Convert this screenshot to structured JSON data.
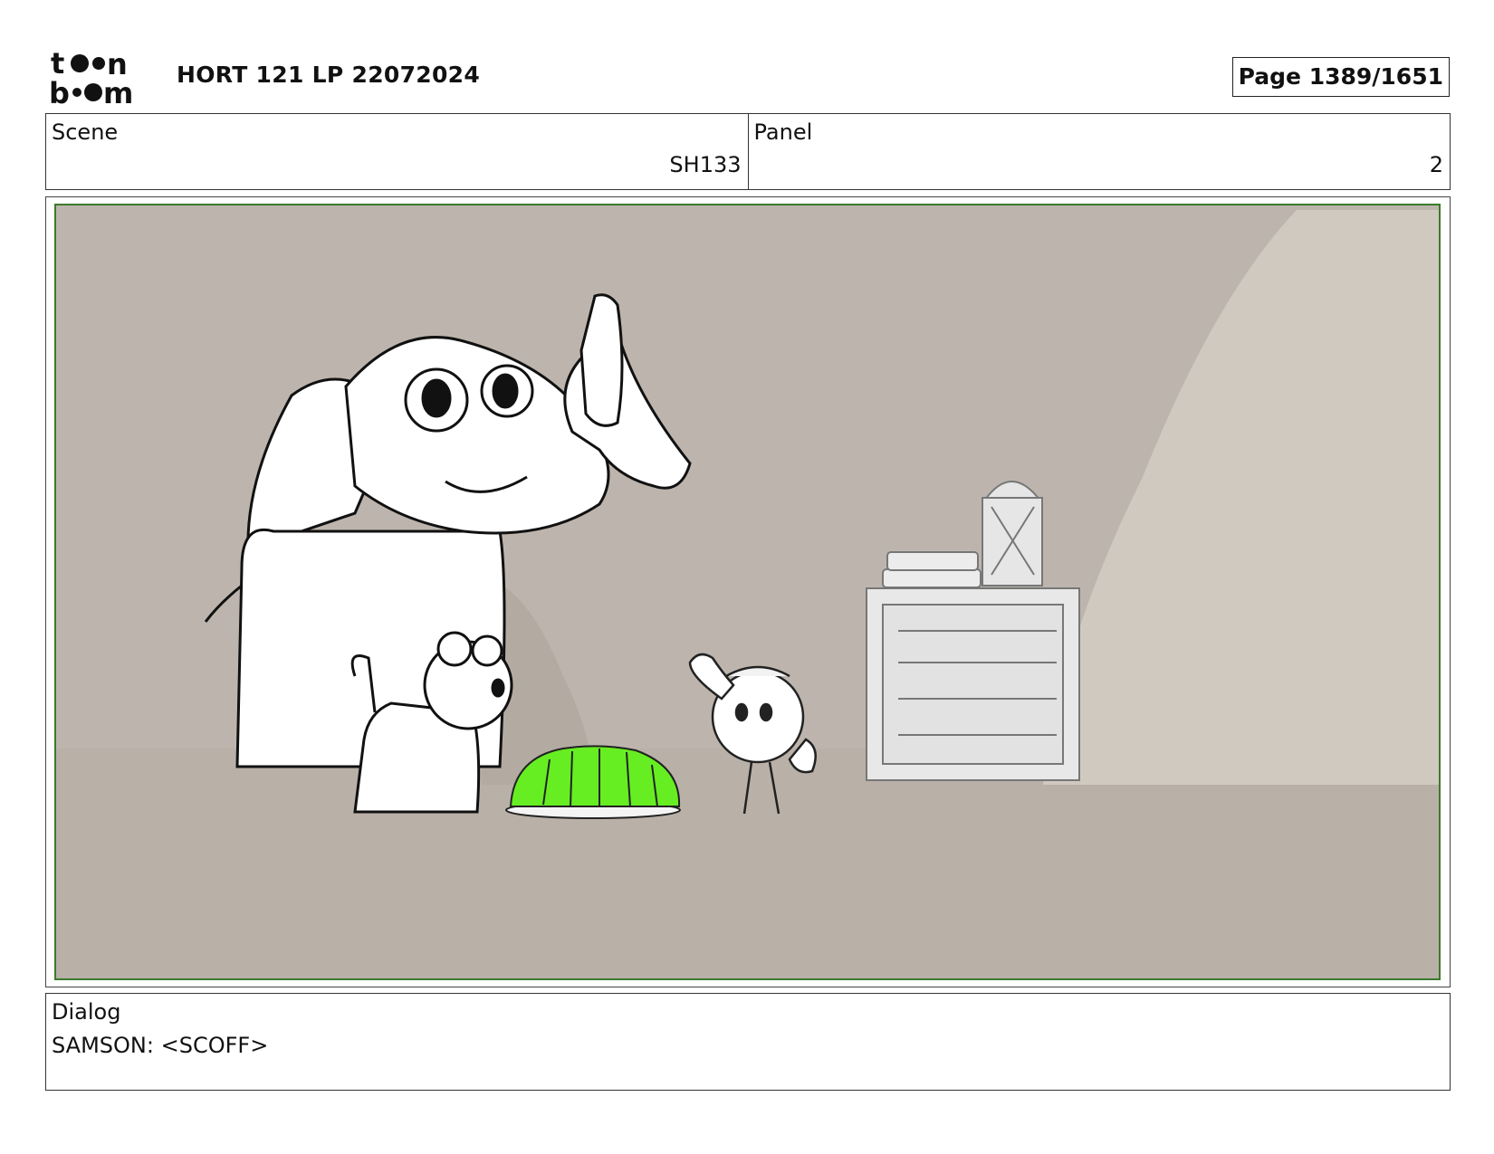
{
  "header": {
    "logo_text_line1": "toon",
    "logo_text_line2": "boom",
    "title": "HORT 121 LP 22072024",
    "page_label": "Page 1389/1651"
  },
  "scene": {
    "label": "Scene",
    "value": "SH133"
  },
  "panel": {
    "label": "Panel",
    "value": "2"
  },
  "artwork": {
    "frame_color": "#3c7a2c",
    "background_color": "#bdb5ad",
    "jelly_color": "#66ee22",
    "characters": [
      "elephant",
      "cat",
      "bird"
    ],
    "props": [
      "green-jelly",
      "crate",
      "books",
      "lantern",
      "rock"
    ]
  },
  "dialog": {
    "label": "Dialog",
    "text": "SAMSON: <SCOFF>"
  }
}
